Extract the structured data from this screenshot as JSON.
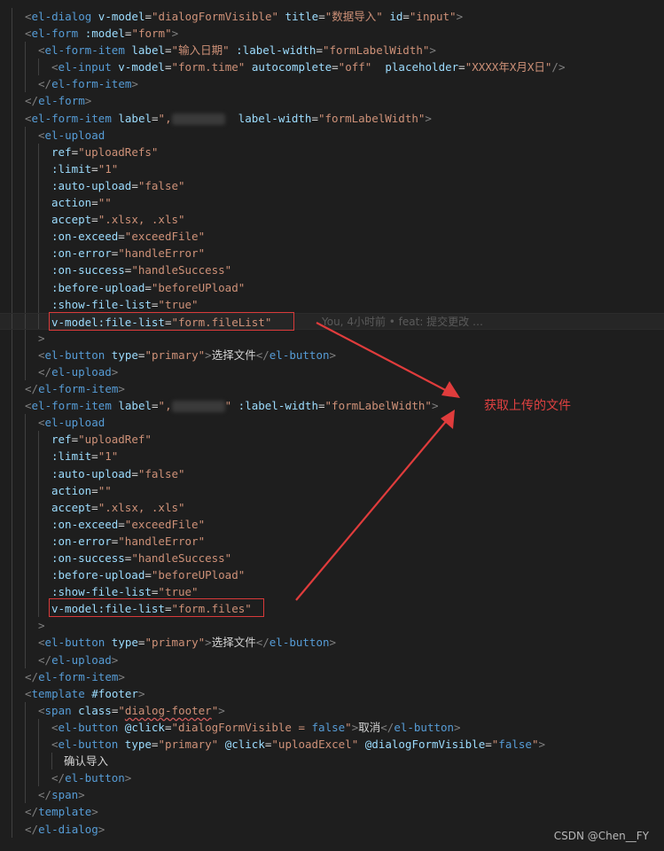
{
  "lines": [
    {
      "indent": 1,
      "tokens": [
        [
          "punc",
          "<"
        ],
        [
          "tag",
          "el-dialog"
        ],
        [
          "txt",
          " "
        ],
        [
          "attr",
          "v-model"
        ],
        [
          "txt",
          "="
        ],
        [
          "str",
          "\"dialogFormVisible\""
        ],
        [
          "txt",
          " "
        ],
        [
          "attr",
          "title"
        ],
        [
          "txt",
          "="
        ],
        [
          "str",
          "\"数据导入\""
        ],
        [
          "txt",
          " "
        ],
        [
          "attr",
          "id"
        ],
        [
          "txt",
          "="
        ],
        [
          "str",
          "\"input\""
        ],
        [
          "punc",
          ">"
        ]
      ]
    },
    {
      "indent": 1,
      "tokens": [
        [
          "punc",
          "<"
        ],
        [
          "tag",
          "el-form"
        ],
        [
          "txt",
          " "
        ],
        [
          "attr",
          ":model"
        ],
        [
          "txt",
          "="
        ],
        [
          "str",
          "\"form\""
        ],
        [
          "punc",
          ">"
        ]
      ]
    },
    {
      "indent": 2,
      "tokens": [
        [
          "punc",
          "<"
        ],
        [
          "tag",
          "el-form-item"
        ],
        [
          "txt",
          " "
        ],
        [
          "attr",
          "label"
        ],
        [
          "txt",
          "="
        ],
        [
          "str",
          "\"输入日期\""
        ],
        [
          "txt",
          " "
        ],
        [
          "attr",
          ":label-width"
        ],
        [
          "txt",
          "="
        ],
        [
          "str",
          "\"formLabelWidth\""
        ],
        [
          "punc",
          ">"
        ]
      ]
    },
    {
      "indent": 3,
      "tokens": [
        [
          "punc",
          "<"
        ],
        [
          "tag",
          "el-input"
        ],
        [
          "txt",
          " "
        ],
        [
          "attr",
          "v-model"
        ],
        [
          "txt",
          "="
        ],
        [
          "str",
          "\"form.time\""
        ],
        [
          "txt",
          " "
        ],
        [
          "attr",
          "autocomplete"
        ],
        [
          "txt",
          "="
        ],
        [
          "str",
          "\"off\""
        ],
        [
          "txt",
          "  "
        ],
        [
          "attr",
          "placeholder"
        ],
        [
          "txt",
          "="
        ],
        [
          "str",
          "\"XXXX年X月X日\""
        ],
        [
          "punc",
          "/>"
        ]
      ]
    },
    {
      "indent": 2,
      "tokens": [
        [
          "punc",
          "</"
        ],
        [
          "tag",
          "el-form-item"
        ],
        [
          "punc",
          ">"
        ]
      ]
    },
    {
      "indent": 1,
      "tokens": [
        [
          "punc",
          "</"
        ],
        [
          "tag",
          "el-form"
        ],
        [
          "punc",
          ">"
        ]
      ]
    },
    {
      "indent": 1,
      "tokens": [
        [
          "punc",
          "<"
        ],
        [
          "tag",
          "el-form-item"
        ],
        [
          "txt",
          " "
        ],
        [
          "attr",
          "label"
        ],
        [
          "txt",
          "="
        ],
        [
          "str",
          "\","
        ],
        [
          "blur",
          ""
        ],
        [
          "txt",
          "  "
        ],
        [
          "attr",
          "label-width"
        ],
        [
          "txt",
          "="
        ],
        [
          "str",
          "\"formLabelWidth\""
        ],
        [
          "punc",
          ">"
        ]
      ]
    },
    {
      "indent": 2,
      "tokens": [
        [
          "punc",
          "<"
        ],
        [
          "tag",
          "el-upload"
        ]
      ]
    },
    {
      "indent": 3,
      "tokens": [
        [
          "attr",
          "ref"
        ],
        [
          "txt",
          "="
        ],
        [
          "str",
          "\"uploadRefs\""
        ]
      ]
    },
    {
      "indent": 3,
      "tokens": [
        [
          "attr",
          ":limit"
        ],
        [
          "txt",
          "="
        ],
        [
          "str",
          "\"1\""
        ]
      ]
    },
    {
      "indent": 3,
      "tokens": [
        [
          "attr",
          ":auto-upload"
        ],
        [
          "txt",
          "="
        ],
        [
          "str",
          "\"false\""
        ]
      ]
    },
    {
      "indent": 3,
      "tokens": [
        [
          "attr",
          "action"
        ],
        [
          "txt",
          "="
        ],
        [
          "str",
          "\"\""
        ]
      ]
    },
    {
      "indent": 3,
      "tokens": [
        [
          "attr",
          "accept"
        ],
        [
          "txt",
          "="
        ],
        [
          "str",
          "\".xlsx, .xls\""
        ]
      ]
    },
    {
      "indent": 3,
      "tokens": [
        [
          "attr",
          ":on-exceed"
        ],
        [
          "txt",
          "="
        ],
        [
          "str",
          "\"exceedFile\""
        ]
      ]
    },
    {
      "indent": 3,
      "tokens": [
        [
          "attr",
          ":on-error"
        ],
        [
          "txt",
          "="
        ],
        [
          "str",
          "\"handleError\""
        ]
      ]
    },
    {
      "indent": 3,
      "tokens": [
        [
          "attr",
          ":on-success"
        ],
        [
          "txt",
          "="
        ],
        [
          "str",
          "\"handleSuccess\""
        ]
      ]
    },
    {
      "indent": 3,
      "tokens": [
        [
          "attr",
          ":before-upload"
        ],
        [
          "txt",
          "="
        ],
        [
          "str",
          "\"beforeUPload\""
        ]
      ]
    },
    {
      "indent": 3,
      "tokens": [
        [
          "attr",
          ":show-file-list"
        ],
        [
          "txt",
          "="
        ],
        [
          "str",
          "\"true\""
        ]
      ]
    },
    {
      "indent": 3,
      "current": true,
      "tokens": [
        [
          "attr",
          "v-model:file-list"
        ],
        [
          "txt",
          "="
        ],
        [
          "str",
          "\"form.fileList\""
        ]
      ]
    },
    {
      "indent": 2,
      "tokens": [
        [
          "punc",
          ">"
        ]
      ]
    },
    {
      "indent": 2,
      "tokens": [
        [
          "punc",
          "<"
        ],
        [
          "tag",
          "el-button"
        ],
        [
          "txt",
          " "
        ],
        [
          "attr",
          "type"
        ],
        [
          "txt",
          "="
        ],
        [
          "str",
          "\"primary\""
        ],
        [
          "punc",
          ">"
        ],
        [
          "txt",
          "选择文件"
        ],
        [
          "punc",
          "</"
        ],
        [
          "tag",
          "el-button"
        ],
        [
          "punc",
          ">"
        ]
      ]
    },
    {
      "indent": 2,
      "tokens": [
        [
          "punc",
          "</"
        ],
        [
          "tag",
          "el-upload"
        ],
        [
          "punc",
          ">"
        ]
      ]
    },
    {
      "indent": 1,
      "tokens": [
        [
          "punc",
          "</"
        ],
        [
          "tag",
          "el-form-item"
        ],
        [
          "punc",
          ">"
        ]
      ]
    },
    {
      "indent": 1,
      "tokens": [
        [
          "punc",
          "<"
        ],
        [
          "tag",
          "el-form-item"
        ],
        [
          "txt",
          " "
        ],
        [
          "attr",
          "label"
        ],
        [
          "txt",
          "="
        ],
        [
          "str",
          "\","
        ],
        [
          "blur",
          ""
        ],
        [
          "str",
          "\""
        ],
        [
          "txt",
          " "
        ],
        [
          "attr",
          ":label-width"
        ],
        [
          "txt",
          "="
        ],
        [
          "str",
          "\"formLabelWidth\""
        ],
        [
          "punc",
          ">"
        ]
      ]
    },
    {
      "indent": 2,
      "tokens": [
        [
          "punc",
          "<"
        ],
        [
          "tag",
          "el-upload"
        ]
      ]
    },
    {
      "indent": 3,
      "tokens": [
        [
          "attr",
          "ref"
        ],
        [
          "txt",
          "="
        ],
        [
          "str",
          "\"uploadRef\""
        ]
      ]
    },
    {
      "indent": 3,
      "tokens": [
        [
          "attr",
          ":limit"
        ],
        [
          "txt",
          "="
        ],
        [
          "str",
          "\"1\""
        ]
      ]
    },
    {
      "indent": 3,
      "tokens": [
        [
          "attr",
          ":auto-upload"
        ],
        [
          "txt",
          "="
        ],
        [
          "str",
          "\"false\""
        ]
      ]
    },
    {
      "indent": 3,
      "tokens": [
        [
          "attr",
          "action"
        ],
        [
          "txt",
          "="
        ],
        [
          "str",
          "\"\""
        ]
      ]
    },
    {
      "indent": 3,
      "tokens": [
        [
          "attr",
          "accept"
        ],
        [
          "txt",
          "="
        ],
        [
          "str",
          "\".xlsx, .xls\""
        ]
      ]
    },
    {
      "indent": 3,
      "tokens": [
        [
          "attr",
          ":on-exceed"
        ],
        [
          "txt",
          "="
        ],
        [
          "str",
          "\"exceedFile\""
        ]
      ]
    },
    {
      "indent": 3,
      "tokens": [
        [
          "attr",
          ":on-error"
        ],
        [
          "txt",
          "="
        ],
        [
          "str",
          "\"handleError\""
        ]
      ]
    },
    {
      "indent": 3,
      "tokens": [
        [
          "attr",
          ":on-success"
        ],
        [
          "txt",
          "="
        ],
        [
          "str",
          "\"handleSuccess\""
        ]
      ]
    },
    {
      "indent": 3,
      "tokens": [
        [
          "attr",
          ":before-upload"
        ],
        [
          "txt",
          "="
        ],
        [
          "str",
          "\"beforeUPload\""
        ]
      ]
    },
    {
      "indent": 3,
      "tokens": [
        [
          "attr",
          ":show-file-list"
        ],
        [
          "txt",
          "="
        ],
        [
          "str",
          "\"true\""
        ]
      ]
    },
    {
      "indent": 3,
      "tokens": [
        [
          "attr",
          "v-model:file-list"
        ],
        [
          "txt",
          "="
        ],
        [
          "str",
          "\"form.files\""
        ]
      ]
    },
    {
      "indent": 2,
      "tokens": [
        [
          "punc",
          ">"
        ]
      ]
    },
    {
      "indent": 2,
      "tokens": [
        [
          "punc",
          "<"
        ],
        [
          "tag",
          "el-button"
        ],
        [
          "txt",
          " "
        ],
        [
          "attr",
          "type"
        ],
        [
          "txt",
          "="
        ],
        [
          "str",
          "\"primary\""
        ],
        [
          "punc",
          ">"
        ],
        [
          "txt",
          "选择文件"
        ],
        [
          "punc",
          "</"
        ],
        [
          "tag",
          "el-button"
        ],
        [
          "punc",
          ">"
        ]
      ]
    },
    {
      "indent": 2,
      "tokens": [
        [
          "punc",
          "</"
        ],
        [
          "tag",
          "el-upload"
        ],
        [
          "punc",
          ">"
        ]
      ]
    },
    {
      "indent": 1,
      "tokens": [
        [
          "punc",
          "</"
        ],
        [
          "tag",
          "el-form-item"
        ],
        [
          "punc",
          ">"
        ]
      ]
    },
    {
      "indent": 1,
      "tokens": [
        [
          "punc",
          "<"
        ],
        [
          "tag",
          "template"
        ],
        [
          "txt",
          " "
        ],
        [
          "attr",
          "#footer"
        ],
        [
          "punc",
          ">"
        ]
      ]
    },
    {
      "indent": 2,
      "tokens": [
        [
          "punc",
          "<"
        ],
        [
          "tag",
          "span"
        ],
        [
          "txt",
          " "
        ],
        [
          "attr",
          "class"
        ],
        [
          "txt",
          "="
        ],
        [
          "str",
          "\""
        ],
        [
          "squig",
          "dialog-footer"
        ],
        [
          "str",
          "\""
        ],
        [
          "punc",
          ">"
        ]
      ]
    },
    {
      "indent": 3,
      "tokens": [
        [
          "punc",
          "<"
        ],
        [
          "tag",
          "el-button"
        ],
        [
          "txt",
          " "
        ],
        [
          "attr",
          "@click"
        ],
        [
          "txt",
          "="
        ],
        [
          "str",
          "\"dialogFormVisible = "
        ],
        [
          "tag",
          "false"
        ],
        [
          "str",
          "\""
        ],
        [
          "punc",
          ">"
        ],
        [
          "txt",
          "取消"
        ],
        [
          "punc",
          "</"
        ],
        [
          "tag",
          "el-button"
        ],
        [
          "punc",
          ">"
        ]
      ]
    },
    {
      "indent": 3,
      "tokens": [
        [
          "punc",
          "<"
        ],
        [
          "tag",
          "el-button"
        ],
        [
          "txt",
          " "
        ],
        [
          "attr",
          "type"
        ],
        [
          "txt",
          "="
        ],
        [
          "str",
          "\"primary\""
        ],
        [
          "txt",
          " "
        ],
        [
          "attr",
          "@click"
        ],
        [
          "txt",
          "="
        ],
        [
          "str",
          "\"uploadExcel\""
        ],
        [
          "txt",
          " "
        ],
        [
          "attr",
          "@dialogFormVisible"
        ],
        [
          "txt",
          "="
        ],
        [
          "str",
          "\""
        ],
        [
          "tag",
          "false"
        ],
        [
          "str",
          "\""
        ],
        [
          "punc",
          ">"
        ]
      ]
    },
    {
      "indent": 4,
      "tokens": [
        [
          "txt",
          "确认导入"
        ]
      ]
    },
    {
      "indent": 3,
      "tokens": [
        [
          "punc",
          "</"
        ],
        [
          "tag",
          "el-button"
        ],
        [
          "punc",
          ">"
        ]
      ]
    },
    {
      "indent": 2,
      "tokens": [
        [
          "punc",
          "</"
        ],
        [
          "tag",
          "span"
        ],
        [
          "punc",
          ">"
        ]
      ]
    },
    {
      "indent": 1,
      "tokens": [
        [
          "punc",
          "</"
        ],
        [
          "tag",
          "template"
        ],
        [
          "punc",
          ">"
        ]
      ]
    },
    {
      "indent": 1,
      "tokens": [
        [
          "punc",
          "</"
        ],
        [
          "tag",
          "el-dialog"
        ],
        [
          "punc",
          ">"
        ]
      ]
    }
  ],
  "blame": "You, 4小时前 • feat: 提交更改 …",
  "annotation": "获取上传的文件",
  "watermark": "CSDN @Chen__FY",
  "colors": {
    "background": "#1e1e1e",
    "tag": "#569cd6",
    "attribute": "#9cdcfe",
    "string": "#ce9178",
    "annotation_red": "#e04141"
  }
}
